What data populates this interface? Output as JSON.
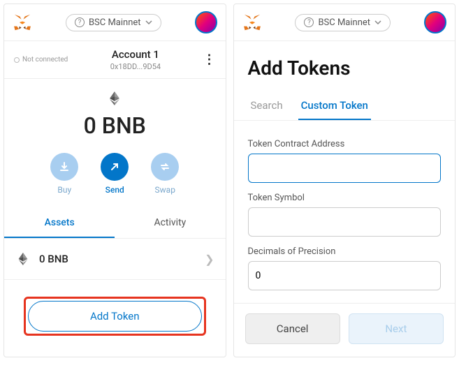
{
  "header": {
    "network_label": "BSC Mainnet"
  },
  "left": {
    "not_connected": "Not connected",
    "account_name": "Account 1",
    "account_addr": "0x18DD...9D54",
    "balance": "0 BNB",
    "actions": {
      "buy": "Buy",
      "send": "Send",
      "swap": "Swap"
    },
    "tabs": {
      "assets": "Assets",
      "activity": "Activity"
    },
    "asset_row": "0 BNB",
    "add_token_btn": "Add Token"
  },
  "right": {
    "title": "Add Tokens",
    "tabs": {
      "search": "Search",
      "custom": "Custom Token"
    },
    "fields": {
      "address_label": "Token Contract Address",
      "address_value": "",
      "symbol_label": "Token Symbol",
      "symbol_value": "",
      "decimals_label": "Decimals of Precision",
      "decimals_value": "0"
    },
    "buttons": {
      "cancel": "Cancel",
      "next": "Next"
    }
  }
}
